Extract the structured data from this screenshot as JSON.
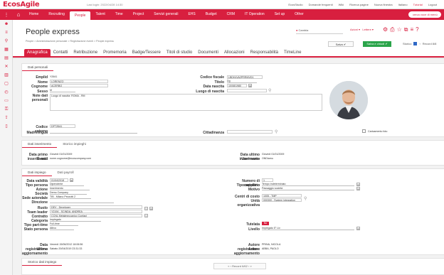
{
  "app": {
    "logo": "EcosAgile",
    "last_login": "Last login: 2022/04/28 14:30"
  },
  "top_links": [
    {
      "label": "EcosStudio",
      "red": false
    },
    {
      "label": "Domande frequenti",
      "red": false
    },
    {
      "label": "Wiki",
      "red": false
    },
    {
      "label": "Ricerca pagine",
      "red": false
    },
    {
      "label": "Nuova finestra",
      "red": false
    },
    {
      "label": "Italiano",
      "red": false
    },
    {
      "label": "Tutorial",
      "red": true
    },
    {
      "label": "Logout",
      "red": false
    }
  ],
  "nav": {
    "items": [
      {
        "label": "Home",
        "active": false
      },
      {
        "label": "Recruiting",
        "active": false
      },
      {
        "label": "People",
        "active": true
      },
      {
        "label": "Talent",
        "active": false
      },
      {
        "label": "Time",
        "active": false
      },
      {
        "label": "Project",
        "active": false
      },
      {
        "label": "Servizi generali",
        "active": false
      },
      {
        "label": "EHS",
        "active": false
      },
      {
        "label": "Budget",
        "active": false
      },
      {
        "label": "CRM",
        "active": false
      },
      {
        "label": "IT Operation",
        "active": false
      },
      {
        "label": "Set up",
        "active": false
      },
      {
        "label": "Other",
        "active": false
      }
    ],
    "search_placeholder": "cerca voce di menù"
  },
  "header": {
    "title": "People express",
    "breadcrumb": "People > Amministrazione personale > Registrazione eventi > People express",
    "cambia": "Cambia",
    "azioni": "Azioni ▾",
    "lettere": "Lettere ▾",
    "save_label": "Salva ✔",
    "save_close_label": "Salva e chiudi ✔",
    "storico_label": "Storico",
    "record_nav": "Record 8/8"
  },
  "tabs": [
    {
      "label": "Anagrafica",
      "active": true
    },
    {
      "label": "Contatti",
      "active": false
    },
    {
      "label": "Retribuzione",
      "active": false
    },
    {
      "label": "Promemoria",
      "active": false
    },
    {
      "label": "Badge/Tessere",
      "active": false
    },
    {
      "label": "Titoli di studio",
      "active": false
    },
    {
      "label": "Documenti",
      "active": false
    },
    {
      "label": "Allocazioni",
      "active": false
    },
    {
      "label": "Responsabilità",
      "active": false
    },
    {
      "label": "TimeLine",
      "active": false
    }
  ],
  "dati_personali": {
    "tab": "Dati personali",
    "emplid_label": "Emplid",
    "emplid": "Y2641",
    "nome_label": "Nome",
    "nome": "LORENZO",
    "cognome_label": "Cognome",
    "cognome": "ACERBO",
    "sesso_label": "Sesso",
    "sesso": "M",
    "note_label": "Note dati personali",
    "note": "Luogo di nascita: ROMA - RM",
    "cf_label": "Codice fiscale",
    "cf": "LBDK4VA2PRRMVD1",
    "titolo_label": "Titolo",
    "titolo": "Dg",
    "nascita_label": "Data nascita",
    "nascita": "10/08/1980",
    "luogo_label": "Luogo di nascita",
    "codice_esterno_label": "Codice esterno",
    "codice_esterno": "DPTZ641",
    "madrelingua_label": "Madrelingua",
    "cittadinanza_label": "Cittadinanza",
    "caricamento_label": "Caricamento foto"
  },
  "dati_inserimento": {
    "tab1": "Dati inserimento",
    "tab2": "Storico impieghi",
    "primo_label": "Data primo inserimento",
    "primo": "Giovedì 01/01/2009",
    "email_label": "E-mail",
    "email": "nome.cognome@ecoscompany.com",
    "ultimo_label": "Data ultimo inserimento",
    "ultimo": "Giovedì 01/01/2009",
    "user_label": "User name",
    "user": "ONDiamu"
  },
  "dati_impiego": {
    "tab1": "Dati impiego",
    "tab2": "Dati payroll",
    "validita_label": "Data validità",
    "validita": "01/04/2018",
    "tipo_persona_label": "Tipo persona",
    "tipo_persona": "Dipendente",
    "azione_label": "Azione",
    "azione": "Inserimento",
    "societa_label": "Società",
    "societa": "Demo Company",
    "sede_label": "Sede aziendale",
    "sede": "TIB - Milano Pezzotti 2",
    "direzione_label": "Direzione",
    "ruolo_label": "Ruolo",
    "ruolo": "DEV - Developer",
    "team_label": "Team leader",
    "team": "Y2194 - SCINDA, ANDREA",
    "contratto_label": "Contratto",
    "contratto": "CCNL Metalmeccanico Confapi",
    "categoria_label": "Categoria",
    "categoria": "Impiegato",
    "tipo_part_label": "Tipo part-time",
    "tipo_part": "Full-time",
    "stato_label": "Stato persona",
    "stato": "Attivo",
    "cartellino_label": "Numero di cartellino",
    "cartellino": "1",
    "tipo_rapporto_label": "Tipo rapporto",
    "tipo_rapporto": "Tempo indeterminato",
    "motivo_label": "Motivo",
    "motivo": "Passaggio società",
    "centro_label": "Centri di costo",
    "centro": "1005 - TMP",
    "unita_label": "Unità organizzativa",
    "unita": "000300 - System integration",
    "tutela_label": "Tutelata",
    "tutela": "No",
    "livello_label": "Livello",
    "livello": "Impiegato 5° Liv",
    "registrazione_label": "Data registrazione",
    "registrazione": "Venerdì 15/06/2012 18:06:56",
    "aggiornamento_label": "Ultimo aggiornamento",
    "aggiornamento": "Sabato 20/04/2019 23:31:33",
    "autore_reg_label": "Autore registrazione",
    "autore_reg": "PRINA, NICOLA",
    "autore_agg_label": "Autore aggiornamento",
    "autore_agg": "ABBA, PAOLO"
  },
  "storico_impiego": {
    "tab": "Storico dati impiego"
  },
  "pager": {
    "label": "Record 6/62"
  }
}
